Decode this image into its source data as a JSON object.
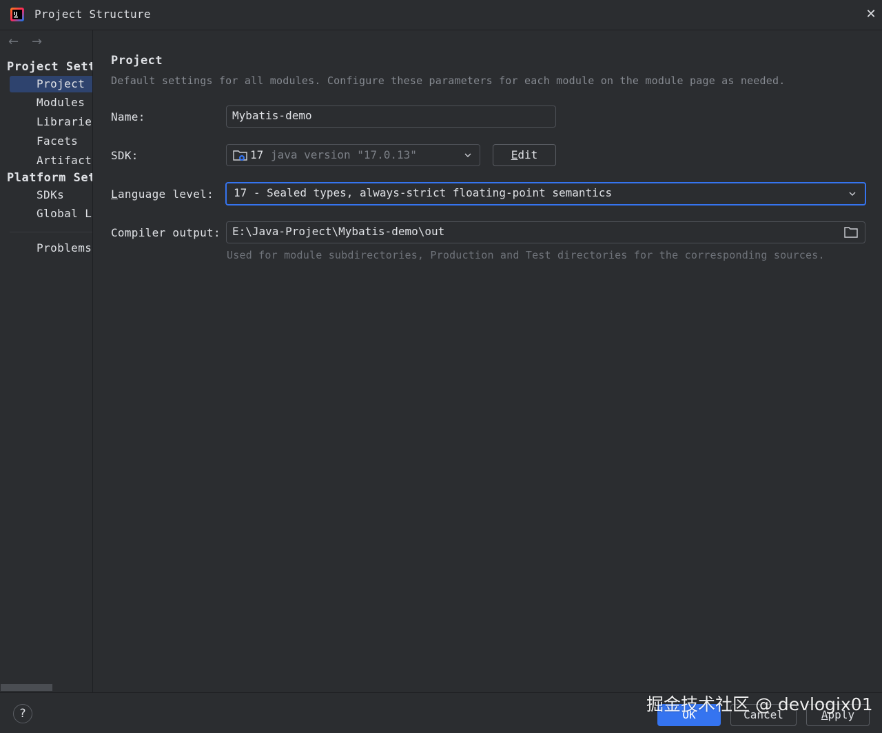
{
  "window": {
    "title": "Project Structure",
    "close_glyph": "✕"
  },
  "sidebar": {
    "back_glyph": "←",
    "forward_glyph": "→",
    "group_project_settings": "Project Sett",
    "group_platform_settings": "Platform Set",
    "items": [
      {
        "label": "Project",
        "selected": true
      },
      {
        "label": "Modules",
        "selected": false
      },
      {
        "label": "Libraries",
        "selected": false
      },
      {
        "label": "Facets",
        "selected": false
      },
      {
        "label": "Artifacts",
        "selected": false
      }
    ],
    "platform_items": [
      {
        "label": "SDKs"
      },
      {
        "label": "Global Libraries"
      }
    ],
    "problems": "Problems"
  },
  "main": {
    "title": "Project",
    "description": "Default settings for all modules. Configure these parameters for each module on the module page as needed.",
    "name_label": "Name:",
    "name_value": "Mybatis-demo",
    "sdk_label": "SDK:",
    "sdk_name": "17",
    "sdk_version": "java version \"17.0.13\"",
    "edit_button_mn": "E",
    "edit_button_rest": "dit",
    "language_label_mn": "L",
    "language_label_rest": "anguage level:",
    "language_value": "17 - Sealed types, always-strict floating-point semantics",
    "compiler_label": "Compiler output:",
    "compiler_value": "E:\\Java-Project\\Mybatis-demo\\out",
    "compiler_hint": "Used for module subdirectories, Production and Test directories for the corresponding sources."
  },
  "footer": {
    "help": "?",
    "ok": "OK",
    "cancel": "Cancel",
    "apply_mn": "A",
    "apply_rest": "pply"
  },
  "watermark": "掘金技术社区 @ devlogix01",
  "colors": {
    "background": "#2b2d30",
    "accent": "#3574f0",
    "selection": "#2e436e"
  },
  "icons": {
    "app": "intellij-idea-icon",
    "folder": "folder-icon",
    "chevron": "chevron-down-icon",
    "help": "help-icon"
  }
}
